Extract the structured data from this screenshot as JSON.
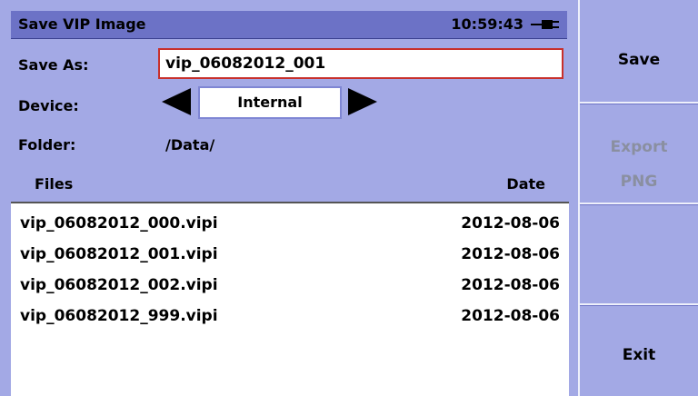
{
  "header": {
    "title": "Save VIP Image",
    "time": "10:59:43",
    "battery_icon": "battery-plug-icon"
  },
  "form": {
    "save_as_label": "Save As:",
    "save_as_value": "vip_06082012_001",
    "device_label": "Device:",
    "device_value": "Internal",
    "folder_label": "Folder:",
    "folder_value": "/Data/"
  },
  "table": {
    "col_files": "Files",
    "col_date": "Date",
    "rows": [
      {
        "name": "vip_06082012_000.vipi",
        "date": "2012-08-06"
      },
      {
        "name": "vip_06082012_001.vipi",
        "date": "2012-08-06"
      },
      {
        "name": "vip_06082012_002.vipi",
        "date": "2012-08-06"
      },
      {
        "name": "vip_06082012_999.vipi",
        "date": "2012-08-06"
      }
    ]
  },
  "softkeys": {
    "save": "Save",
    "export_line1": "Export",
    "export_line2": "PNG",
    "exit": "Exit"
  },
  "colors": {
    "panel": "#a3a9e5",
    "titlebar": "#6c72c6",
    "input_border": "#c8302c",
    "disabled_text": "#8a8fa0"
  }
}
